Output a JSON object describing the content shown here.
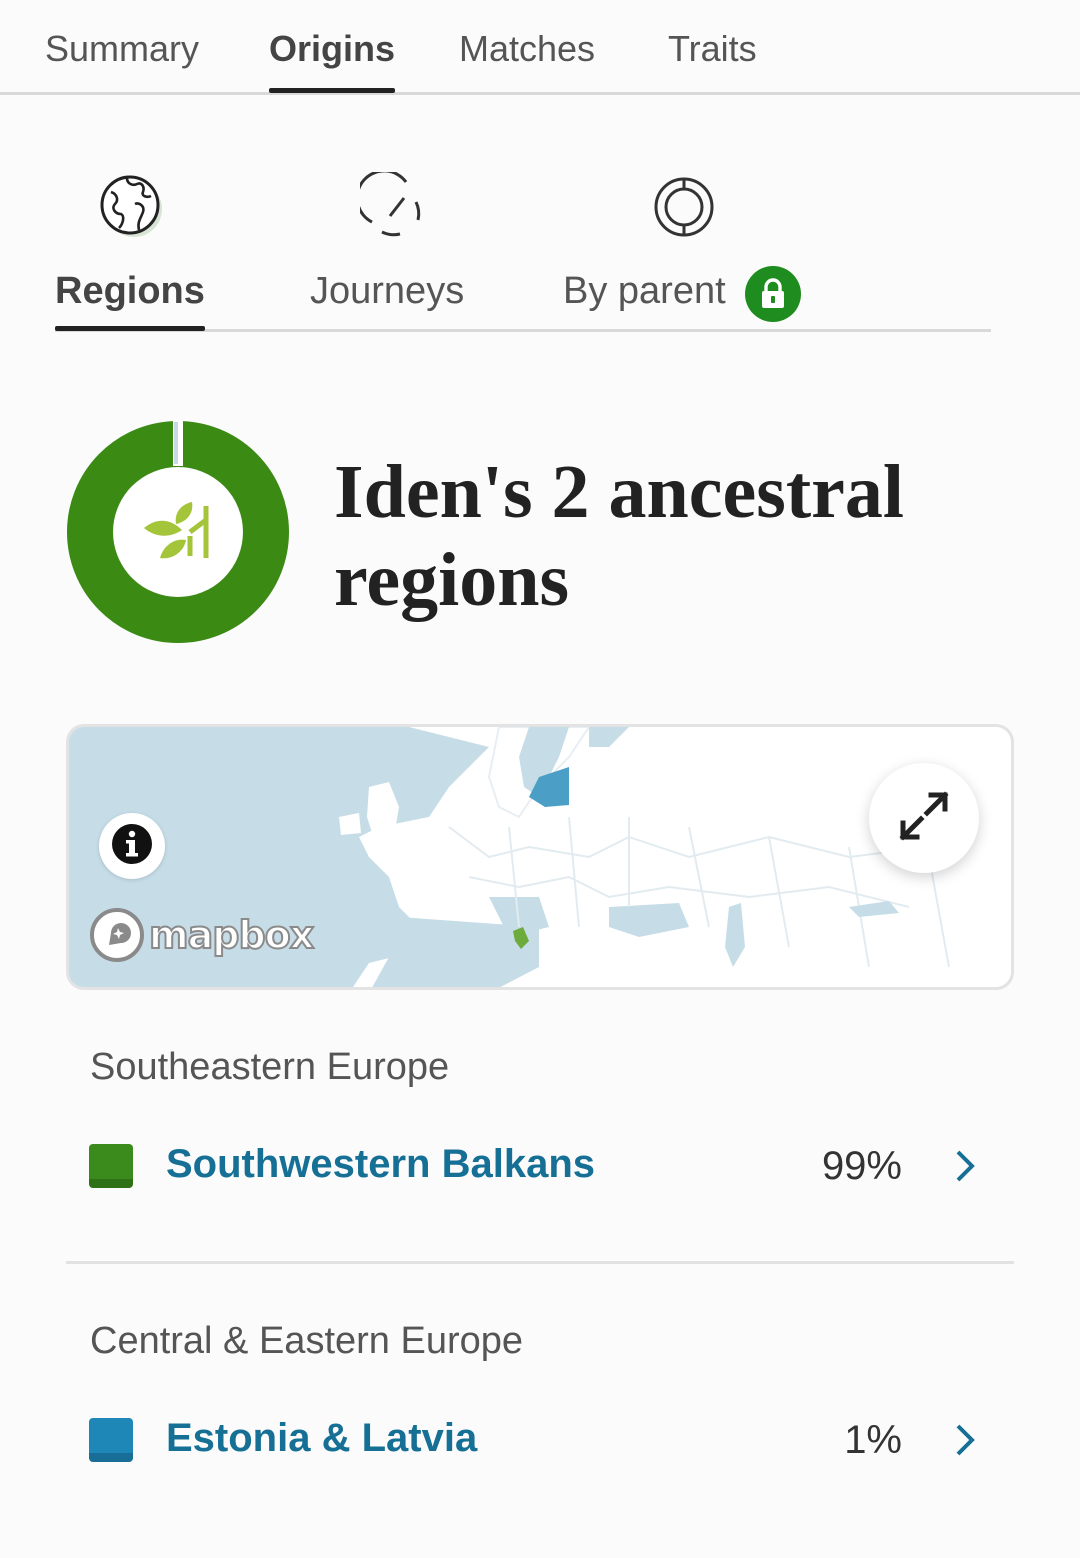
{
  "top_tabs": [
    {
      "label": "Summary"
    },
    {
      "label": "Origins"
    },
    {
      "label": "Matches"
    },
    {
      "label": "Traits"
    }
  ],
  "active_top_tab": "Origins",
  "sub_tabs": [
    {
      "label": "Regions",
      "icon": "globe-icon"
    },
    {
      "label": "Journeys",
      "icon": "journeys-icon"
    },
    {
      "label": "By parent",
      "icon": "parent-circle-icon",
      "badge_icon": "lock-icon"
    }
  ],
  "active_sub_tab": "Regions",
  "header": {
    "title": "Iden's 2 ancestral regions",
    "logo_icon": "ancestry-leaf-icon"
  },
  "map": {
    "attribution": "mapbox",
    "info_icon": "info-icon",
    "expand_icon": "expand-icon"
  },
  "groups": [
    {
      "title": "Southeastern Europe",
      "regions": [
        {
          "name": "Southwestern Balkans",
          "percent": "99%",
          "color": "#3a8a1c"
        }
      ]
    },
    {
      "title": "Central & Eastern Europe",
      "regions": [
        {
          "name": "Estonia & Latvia",
          "percent": "1%",
          "color": "#1e87b8"
        }
      ]
    }
  ],
  "colors": {
    "accent_green": "#3a8a1c",
    "link_blue": "#166f95",
    "lock_badge": "#1f8c1f"
  }
}
